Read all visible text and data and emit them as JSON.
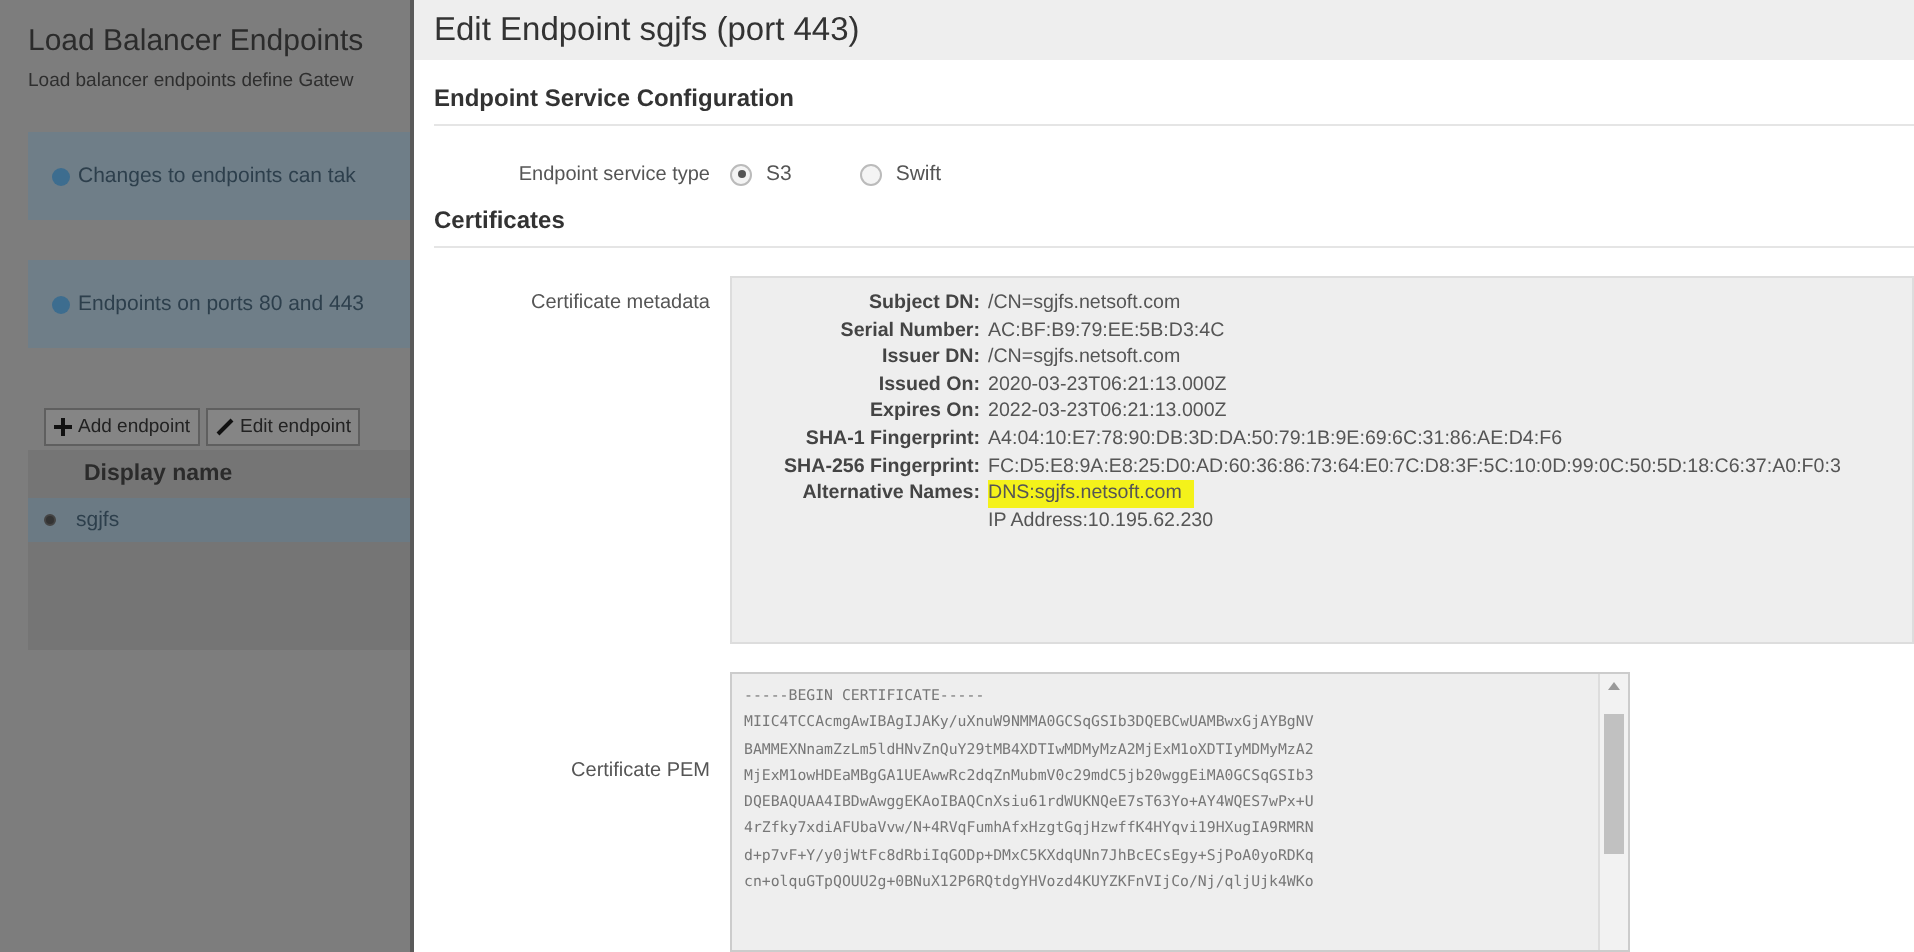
{
  "background_page": {
    "title": "Load Balancer Endpoints",
    "description": "Load balancer endpoints define Gatew",
    "notices": [
      "Changes to endpoints can tak",
      "Endpoints on ports 80 and 443"
    ],
    "toolbar": [
      {
        "kind": "add",
        "label": "Add endpoint"
      },
      {
        "kind": "edit",
        "label": "Edit endpoint"
      }
    ],
    "table": {
      "columns": [
        "Display name"
      ],
      "rows": [
        {
          "name": "sgjfs",
          "selected": true
        }
      ]
    }
  },
  "dialog": {
    "title": "Edit Endpoint sgjfs (port 443)",
    "service_section": {
      "heading": "Endpoint Service Configuration",
      "label": "Endpoint service type",
      "options": [
        {
          "label": "S3",
          "selected": true
        },
        {
          "label": "Swift",
          "selected": false
        }
      ]
    },
    "certificates": {
      "heading": "Certificates",
      "metadata_label": "Certificate metadata",
      "metadata": [
        {
          "label": "Subject DN:",
          "values": [
            {
              "text": "/CN=sgjfs.netsoft.com",
              "highlighted": false
            }
          ]
        },
        {
          "label": "Serial Number:",
          "values": [
            {
              "text": "AC:BF:B9:79:EE:5B:D3:4C",
              "highlighted": false
            }
          ]
        },
        {
          "label": "Issuer DN:",
          "values": [
            {
              "text": "/CN=sgjfs.netsoft.com",
              "highlighted": false
            }
          ]
        },
        {
          "label": "Issued On:",
          "values": [
            {
              "text": "2020-03-23T06:21:13.000Z",
              "highlighted": false
            }
          ]
        },
        {
          "label": "Expires On:",
          "values": [
            {
              "text": "2022-03-23T06:21:13.000Z",
              "highlighted": false
            }
          ]
        },
        {
          "label": "SHA-1 Fingerprint:",
          "values": [
            {
              "text": "A4:04:10:E7:78:90:DB:3D:DA:50:79:1B:9E:69:6C:31:86:AE:D4:F6",
              "highlighted": false
            }
          ]
        },
        {
          "label": "SHA-256 Fingerprint:",
          "values": [
            {
              "text": "FC:D5:E8:9A:E8:25:D0:AD:60:36:86:73:64:E0:7C:D8:3F:5C:10:0D:99:0C:50:5D:18:C6:37:A0:F0:3",
              "highlighted": false
            }
          ]
        },
        {
          "label": "Alternative Names:",
          "values": [
            {
              "text": "DNS:sgjfs.netsoft.com",
              "highlighted": true
            },
            {
              "text": "IP Address:10.195.62.230",
              "highlighted": false
            }
          ]
        }
      ],
      "pem_label": "Certificate PEM",
      "pem_lines": [
        "-----BEGIN CERTIFICATE-----",
        "MIIC4TCCAcmgAwIBAgIJAKy/uXnuW9NMMA0GCSqGSIb3DQEBCwUAMBwxGjAYBgNV",
        "BAMMEXNnamZzLm5ldHNvZnQuY29tMB4XDTIwMDMyMzA2MjExM1oXDTIyMDMyMzA2",
        "MjExM1owHDEaMBgGA1UEAwwRc2dqZnMubmV0c29mdC5jb20wggEiMA0GCSqGSIb3",
        "DQEBAQUAA4IBDwAwggEKAoIBAQCnXsiu61rdWUKNQeE7sT63Yo+AY4WQES7wPx+U",
        "4rZfky7xdiAFUbaVvw/N+4RVqFumhAfxHzgtGqjHzwffK4HYqvi19HXugIA9RMRN",
        "d+p7vF+Y/y0jWtFc8dRbiIqGODp+DMxC5KXdqUNn7JhBcECsEgy+SjPoA0yoRDKq",
        "cn+olquGTpQOUU2g+0BNuX12P6RQtdgYHVozd4KUYZKFnVIjCo/Nj/qljUjk4WKo"
      ]
    }
  }
}
